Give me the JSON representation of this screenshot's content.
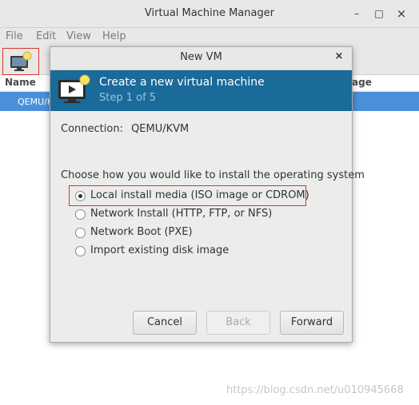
{
  "main_window": {
    "title": "Virtual Machine Manager",
    "controls": {
      "minimize": "–",
      "maximize": "□",
      "close": "×"
    },
    "menu": [
      "File",
      "Edit",
      "View",
      "Help"
    ],
    "list": {
      "columns": {
        "name": "Name",
        "usage": "age"
      },
      "rows": [
        {
          "name": "QEMU/K"
        }
      ]
    }
  },
  "dialog": {
    "title": "New VM",
    "close_glyph": "×",
    "banner": {
      "title": "Create a new virtual machine",
      "step": "Step 1 of 5",
      "icon": "monitor-icon"
    },
    "connection_label": "Connection:",
    "connection_value": "QEMU/KVM",
    "prompt": "Choose how you would like to install the operating system",
    "options": [
      {
        "label": "Local install media (ISO image or CDROM)",
        "selected": true
      },
      {
        "label": "Network Install (HTTP, FTP, or NFS)",
        "selected": false
      },
      {
        "label": "Network Boot (PXE)",
        "selected": false
      },
      {
        "label": "Import existing disk image",
        "selected": false
      }
    ],
    "buttons": {
      "cancel": "Cancel",
      "back": "Back",
      "forward": "Forward"
    },
    "accent_color": "#1a6a9a"
  },
  "watermark": "https://blog.csdn.net/u010945668"
}
